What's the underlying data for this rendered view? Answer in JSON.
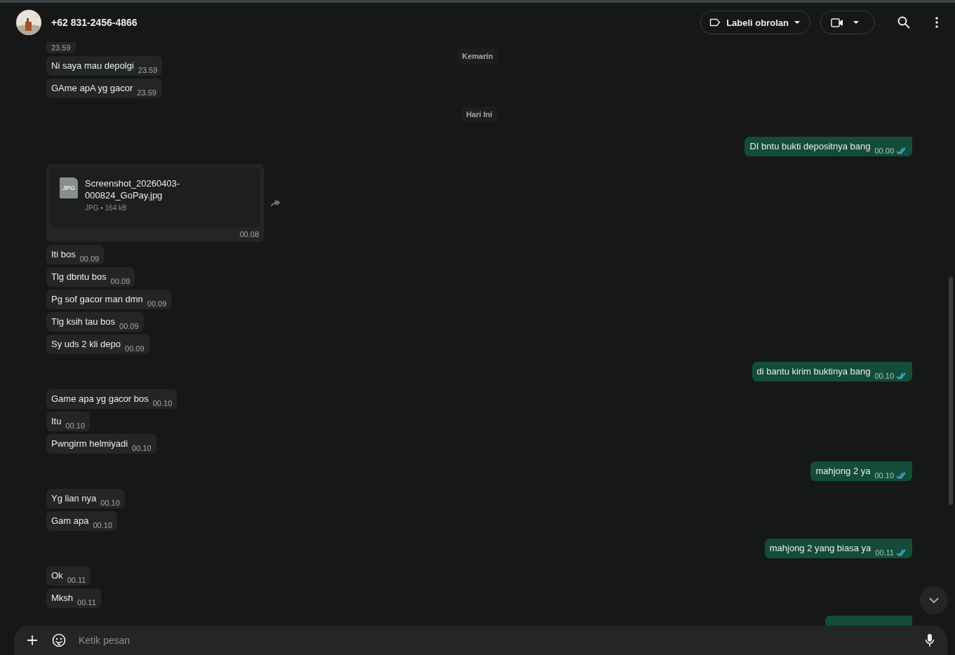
{
  "header": {
    "contact": "+62 831-2456-4866",
    "label_button": "Labeli obrolan"
  },
  "sticky_date": "Kemarin",
  "items": [
    {
      "kind": "in_message",
      "time": "23.59"
    },
    {
      "kind": "in_message",
      "text": "Ni saya mau depolgi",
      "time": "23.59"
    },
    {
      "kind": "in_message",
      "text": "GAme apA yg gacor",
      "time": "23.59"
    },
    {
      "kind": "date",
      "text": "Hari Ini"
    },
    {
      "kind": "out_message",
      "text": "DI bntu bukti depositnya bang",
      "time": "00.00",
      "read": true
    },
    {
      "kind": "file",
      "icon_label": "JPG",
      "name": "Screenshot_20260403-000824_GoPay.jpg",
      "meta": "JPG • 164 kB",
      "time": "00.08"
    },
    {
      "kind": "in_message",
      "text": "Iti bos",
      "time": "00.09"
    },
    {
      "kind": "in_message",
      "text": "Tlg dbntu bos",
      "time": "00.09"
    },
    {
      "kind": "in_message",
      "text": "Pg sof gacor man dmn",
      "time": "00.09"
    },
    {
      "kind": "in_message",
      "text": "Tlg ksih tau bos",
      "time": "00.09"
    },
    {
      "kind": "in_message",
      "text": "Sy uds 2 kli depo",
      "time": "00.09"
    },
    {
      "kind": "out_message",
      "text": "di bantu kirim buktinya bang",
      "time": "00.10",
      "read": true
    },
    {
      "kind": "in_message",
      "text": "Game apa yg gacor bos",
      "time": "00.10"
    },
    {
      "kind": "in_message",
      "text": "Itu",
      "time": "00.10"
    },
    {
      "kind": "in_message",
      "text": "Pwngirm helmiyadi",
      "time": "00.10"
    },
    {
      "kind": "out_message",
      "text": "mahjong 2 ya",
      "time": "00.10",
      "read": true
    },
    {
      "kind": "in_message",
      "text": "Yg lian nya",
      "time": "00.10"
    },
    {
      "kind": "in_message",
      "text": "Gam apa",
      "time": "00.10"
    },
    {
      "kind": "out_message",
      "text": "mahjong 2 yang biasa ya",
      "time": "00.11",
      "read": true
    },
    {
      "kind": "in_message",
      "text": "Ok",
      "time": "00.11"
    },
    {
      "kind": "in_message",
      "text": "Mksh",
      "time": "00.11"
    },
    {
      "kind": "out_message"
    }
  ],
  "composer": {
    "placeholder": "Ketik pesan"
  }
}
